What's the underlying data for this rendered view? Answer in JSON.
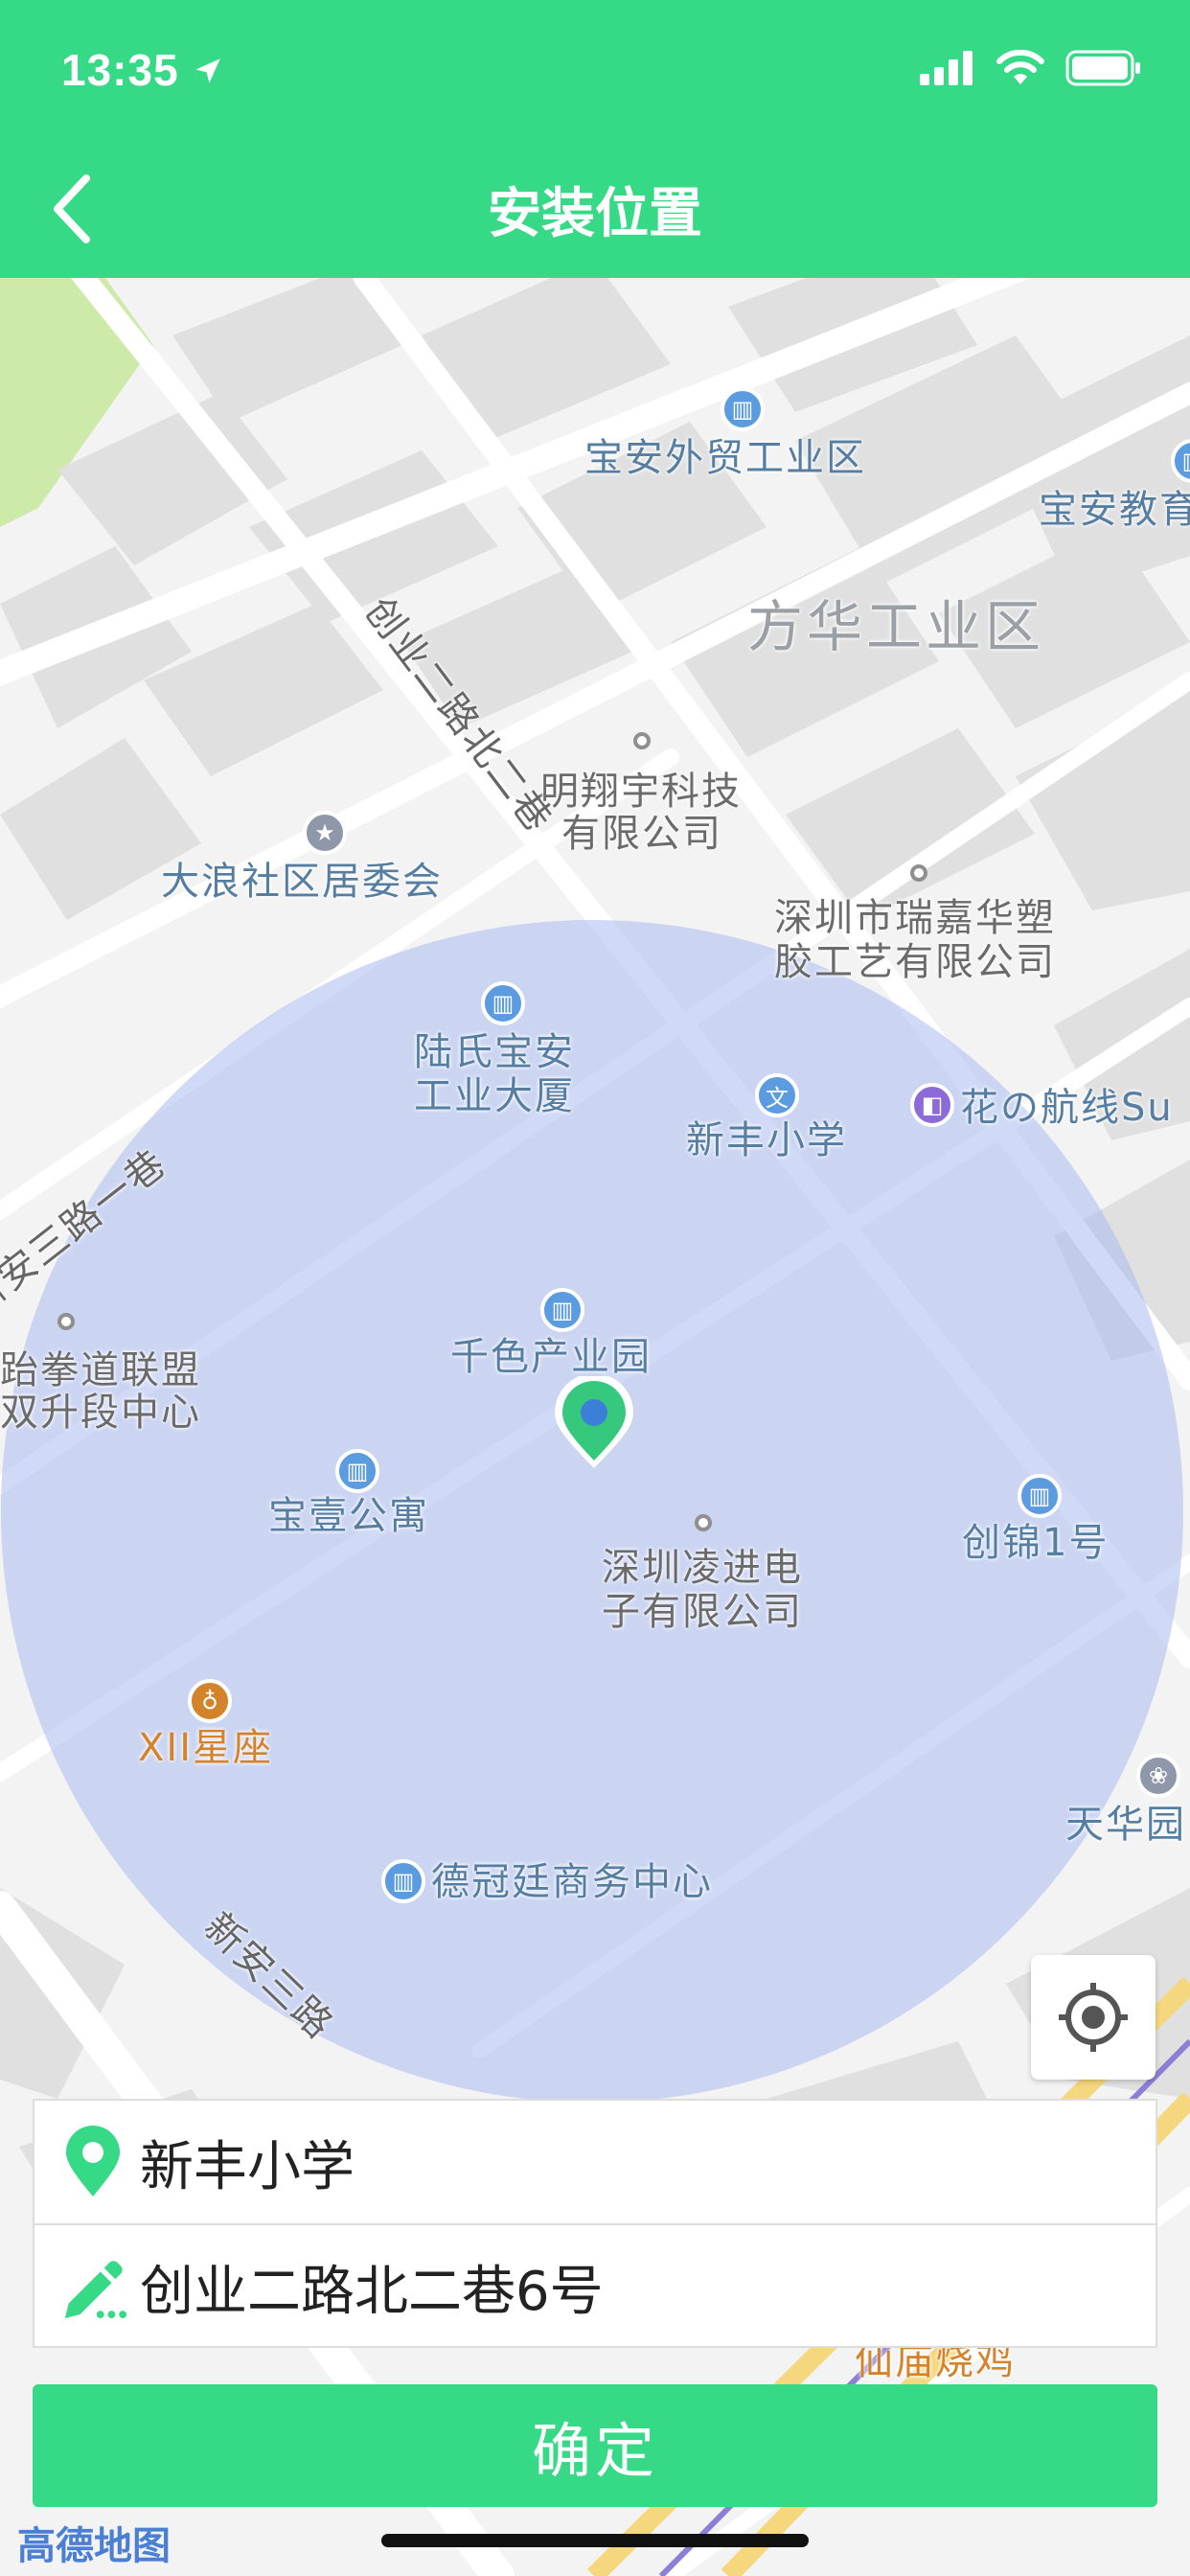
{
  "status_bar": {
    "time": "13:35"
  },
  "header": {
    "title": "安装位置"
  },
  "map": {
    "labels": {
      "baoan_trade": "宝安外贸工业区",
      "baoan_edu": "宝安教育",
      "fanghua": "方华工业区",
      "chuangye_road": "创业二路北二巷",
      "mingxiangyu_1": "明翔宇科技",
      "mingxiangyu_2": "有限公司",
      "dalang": "大浪社区居委会",
      "ruijia_1": "深圳市瑞嘉华塑",
      "ruijia_2": "胶工艺有限公司",
      "lushi_1": "陆氏宝安",
      "lushi_2": "工业大厦",
      "xinan3_lane": "新安三路一巷",
      "xinfeng_school": "新丰小学",
      "huahangxian": "花の航线Su",
      "taekwondo_1": "跆拳道联盟",
      "taekwondo_2": "双升段中心",
      "qianse": "千色产业园",
      "baoyi": "宝壹公寓",
      "lingjin_1": "深圳凌进电",
      "lingjin_2": "子有限公司",
      "chuangjin": "创锦1号",
      "xii": "XII星座",
      "tianhua": "天华园",
      "deguanting": "德冠廷商务中心",
      "xinan3_road": "新安三路",
      "xianmiao": "仙庙烧鸡"
    }
  },
  "form": {
    "place_name": "新丰小学",
    "address": "创业二路北二巷6号"
  },
  "confirm_label": "确定",
  "map_attribution": "高德地图",
  "colors": {
    "accent": "#36d985",
    "poi_blue": "#5b9be0",
    "radius_fill": "#aabcf0"
  },
  "icons": [
    "location-arrow-icon",
    "signal-icon",
    "wifi-icon",
    "battery-icon",
    "back-chevron-icon",
    "map-pin-icon",
    "pencil-icon",
    "locate-icon"
  ]
}
